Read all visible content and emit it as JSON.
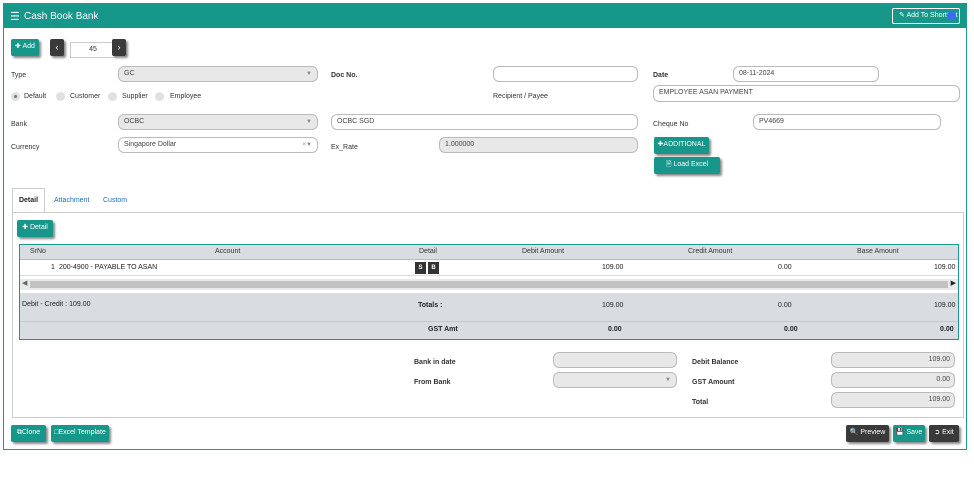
{
  "header": {
    "title": "Cash Book Bank",
    "shortcut_label": "Add To ShortCut"
  },
  "toolbar": {
    "add_label": "Add",
    "record_number": "45"
  },
  "form": {
    "type_label": "Type",
    "type_value": "GC",
    "doc_no_label": "Doc No.",
    "doc_no_value": "",
    "date_label": "Date",
    "date_value": "08-11-2024",
    "radio_default": "Default",
    "radio_customer": "Customer",
    "radio_supplier": "Supplier",
    "radio_employee": "Employee",
    "recipient_label": "Recipient / Payee",
    "recipient_value": "EMPLOYEE ASAN PAYMENT",
    "bank_label": "Bank",
    "bank_value": "OCBC",
    "bank_name_value": "OCBC SGD",
    "cheque_label": "Cheque No",
    "cheque_value": "PV4669",
    "currency_label": "Currency",
    "currency_value": "Singapore Dollar",
    "ex_rate_label": "Ex_Rate",
    "ex_rate_value": "1.000000",
    "additional_label": "ADDITIONAL",
    "load_excel_label": "Load Excel"
  },
  "tabs": [
    "Detail",
    "Attachment",
    "Custom"
  ],
  "detail": {
    "add_detail_label": "Detail",
    "columns": [
      "SrNo",
      "Account",
      "Detail",
      "Debit Amount",
      "Credit Amount",
      "Base Amount"
    ],
    "rows": [
      {
        "srno": "1",
        "account": "200-4900 - PAYABLE TO ASAN",
        "s": "S",
        "b": "B",
        "debit": "109.00",
        "credit": "0.00",
        "base": "109.00"
      }
    ],
    "debit_credit_text": "Debit - Credit : 109.00",
    "totals_label": "Totals :",
    "totals_debit": "109.00",
    "totals_credit": "0.00",
    "totals_base": "109.00",
    "gst_label": "GST Amt",
    "gst_debit": "0.00",
    "gst_credit": "0.00",
    "gst_base": "0.00"
  },
  "summary": {
    "bank_in_date_label": "Bank in date",
    "bank_in_date_value": "",
    "from_bank_label": "From Bank",
    "from_bank_value": "",
    "debit_balance_label": "Debit Balance",
    "debit_balance_value": "109.00",
    "gst_amount_label": "GST Amount",
    "gst_amount_value": "0.00",
    "total_label": "Total",
    "total_value": "109.00"
  },
  "footer": {
    "clone_label": "Clone",
    "excel_template_label": "Excel Template",
    "preview_label": "Preview",
    "save_label": "Save",
    "exit_label": "Exit"
  },
  "colors": {
    "accent": "#17968a",
    "dark_button": "#3a3a3a",
    "grid_header": "#d9dde2"
  }
}
